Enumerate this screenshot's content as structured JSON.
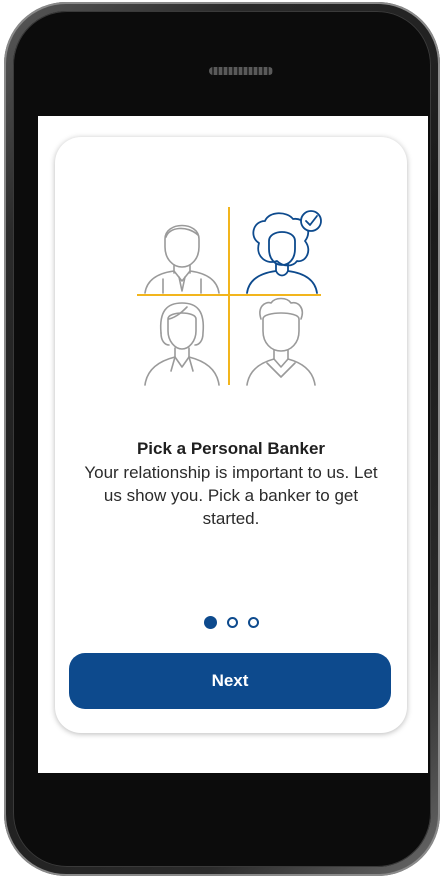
{
  "onboarding": {
    "title": "Pick a Personal Banker",
    "body": "Your relationship is important to us. Let us show you. Pick a banker to get started.",
    "page_count": 3,
    "active_page": 1,
    "next_label": "Next"
  },
  "colors": {
    "accent": "#0d4a8d",
    "divider": "#f2b51d",
    "icon_gray": "#9a9a9a",
    "icon_selected": "#0d4a8d"
  },
  "icons": [
    "banker-man-icon",
    "banker-woman-selected-icon",
    "checkmark-badge-icon",
    "banker-woman-icon",
    "banker-man-2-icon"
  ]
}
